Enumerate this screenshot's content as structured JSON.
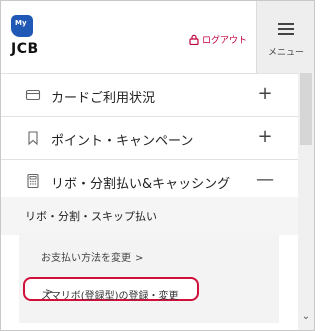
{
  "header": {
    "logo_badge": "My",
    "logo_text": "JCB",
    "logout_label": "ログアウト",
    "menu_label": "メニュー"
  },
  "nav": {
    "items": [
      {
        "label": "カードご利用状況",
        "sign": "+",
        "icon": "credit-card-icon"
      },
      {
        "label": "ポイント・キャンペーン",
        "sign": "+",
        "icon": "bookmark-icon"
      },
      {
        "label": "リボ・分割払い&キャッシング",
        "sign": "—",
        "icon": "calculator-icon"
      }
    ]
  },
  "submenu": {
    "heading": "リボ・分割・スキップ払い",
    "link1": "お支払い方法を変更",
    "link2": "スマリボ(登録型)の登録・変更",
    "arrow": ">"
  },
  "colors": {
    "accent": "#c0003a",
    "highlight_border": "#d0103a",
    "logo_blue": "#1f58b5"
  }
}
